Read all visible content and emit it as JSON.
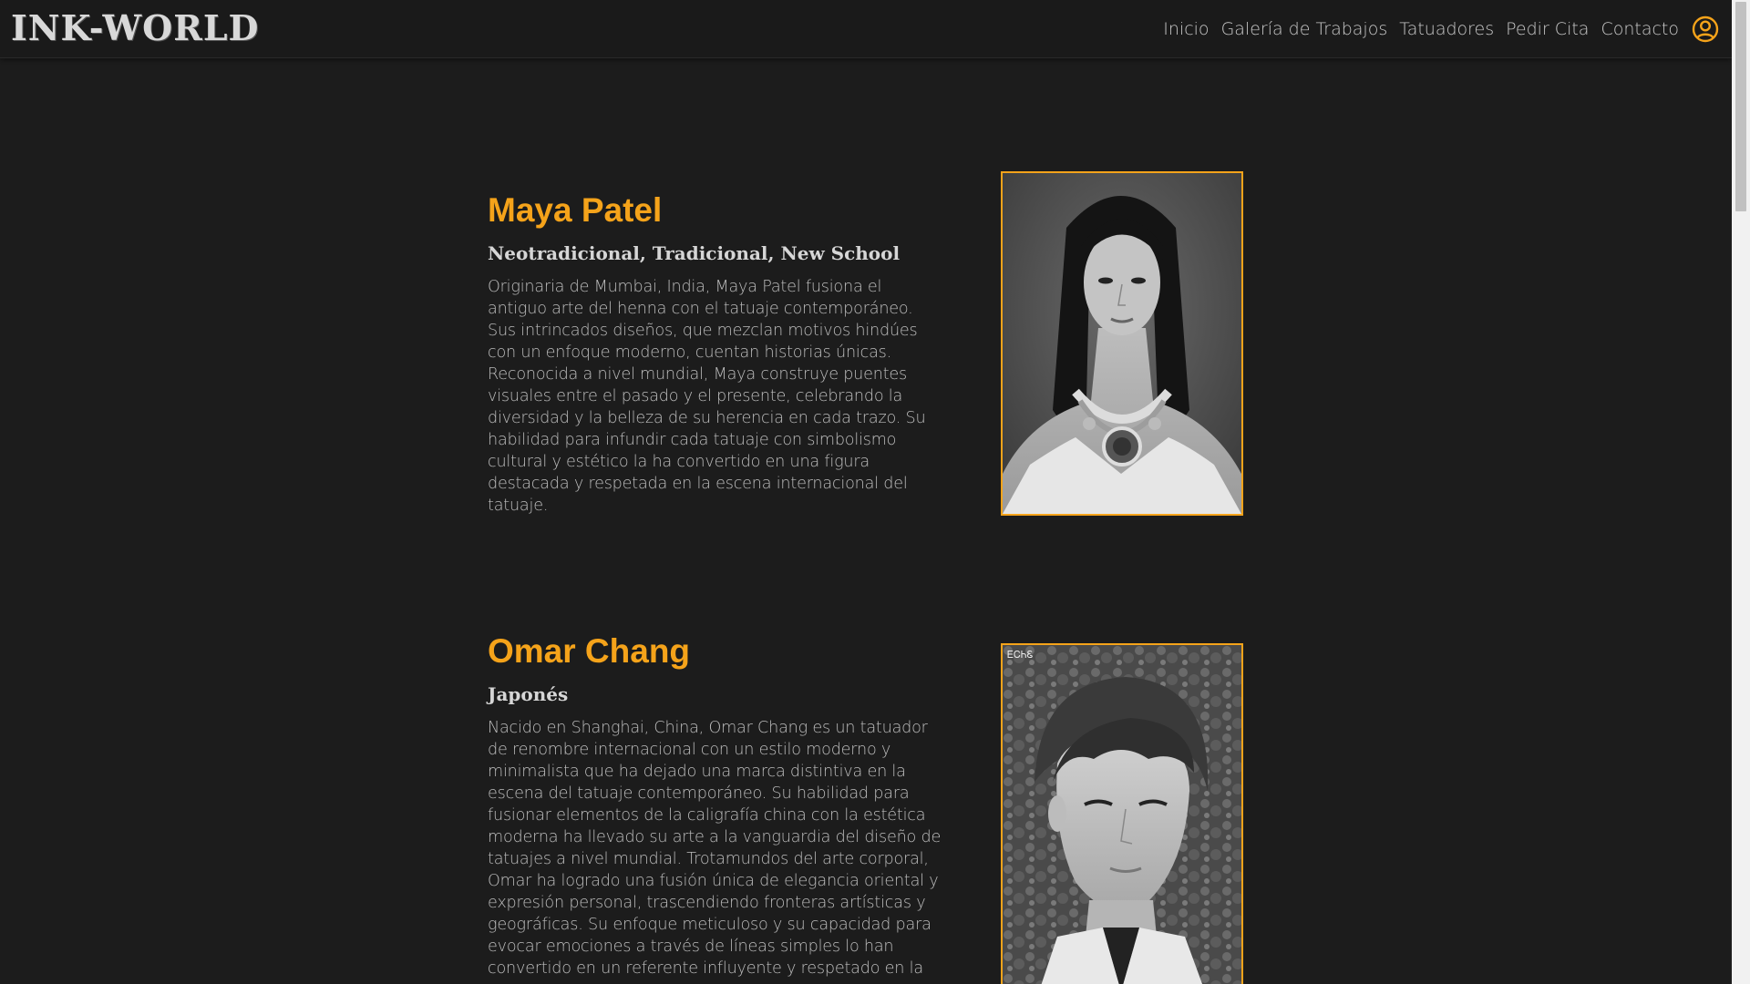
{
  "brand": "INK-WORLD",
  "nav": {
    "items": [
      "Inicio",
      "Galería de Trabajos",
      "Tatuadores",
      "Pedir Cita",
      "Contacto"
    ],
    "user_icon": "user-circle-icon"
  },
  "colors": {
    "accent": "#f5a31a",
    "background": "#1c1c1c",
    "navbar": "#1a1a1a"
  },
  "artists": [
    {
      "name": "Maya Patel",
      "styles": "Neotradicional, Tradicional, New School",
      "bio": "Originaria de Mumbai, India, Maya Patel fusiona el antiguo arte del henna con el tatuaje contemporáneo. Sus intrincados diseños, que mezclan motivos hindúes con un enfoque moderno, cuentan historias únicas. Reconocida a nivel mundial, Maya construye puentes visuales entre el pasado y el presente, celebrando la diversidad y la belleza de su herencia en cada trazo. Su habilidad para infundir cada tatuaje con simbolismo cultural y estético la ha convertido en una figura destacada y respetada en la escena internacional del tatuaje."
    },
    {
      "name": "Omar Chang",
      "styles": "Japonés",
      "bio": "Nacido en Shanghai, China, Omar Chang es un tatuador de renombre internacional con un estilo moderno y minimalista que ha dejado una marca distintiva en la escena del tatuaje contemporáneo. Su habilidad para fusionar elementos de la caligrafía china con la estética moderna ha llevado su arte a la vanguardia del diseño de tatuajes a nivel mundial. Trotamundos del arte corporal, Omar ha logrado una fusión única de elegancia oriental y expresión personal, trascendiendo fronteras artísticas y geográficas. Su enfoque meticuloso y su capacidad para evocar emociones a través de líneas simples lo han convertido en un referente influyente y respetado en la",
      "photo_caption": "ᎬᏟᏂᏋ"
    }
  ]
}
